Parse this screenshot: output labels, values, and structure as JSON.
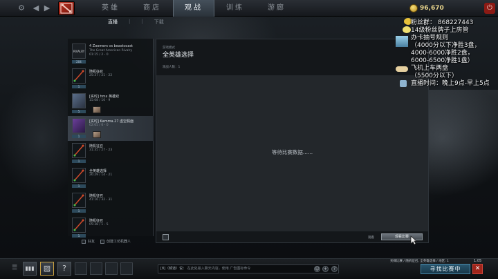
{
  "top_nav": {
    "tabs": [
      {
        "label": "英雄"
      },
      {
        "label": "商店"
      },
      {
        "label": "观战"
      },
      {
        "label": "训练"
      },
      {
        "label": "游廊"
      }
    ],
    "active_index": 2,
    "gold": "96,670"
  },
  "sub_tabs": {
    "items": [
      {
        "label": "直播"
      },
      {
        "label": "|"
      },
      {
        "label": "|"
      },
      {
        "label": "下载"
      }
    ],
    "active_index": 0
  },
  "games": [
    {
      "title": "4 Zoomers vs beastcoast",
      "subtitle": "The Great American Rivalry",
      "time": "01:15 / 2 - 0",
      "viewers": "204"
    },
    {
      "title": "随机征召",
      "subtitle": "25:37 / 21 - 22",
      "time": "",
      "viewers": "1"
    },
    {
      "title": "[实时] hmx 英雄双",
      "subtitle": "15:08 / 10 - 9",
      "time": "",
      "viewers": "5"
    },
    {
      "title": "[实时] Kamma.27 虚空假面",
      "subtitle": "02:05 / 0 - 0",
      "time": "",
      "viewers": "1"
    },
    {
      "title": "随机征召",
      "subtitle": "31:35 / 27 - 23",
      "time": "",
      "viewers": "1"
    },
    {
      "title": "全英雄选择",
      "subtitle": "26:29 / 14 - 21",
      "time": "",
      "viewers": "1"
    },
    {
      "title": "随机征召",
      "subtitle": "41:16 / 32 - 31",
      "time": "",
      "viewers": "1"
    },
    {
      "title": "随机征召",
      "subtitle": "05:38 / 1 - 5",
      "time": "",
      "viewers": "1"
    }
  ],
  "list_filters": [
    {
      "label": "好友"
    },
    {
      "label": "创建工坊机器人"
    }
  ],
  "detail": {
    "mode_label": "游戏模式",
    "mode": "全英雄选择",
    "viewers_label": "观战人数：1",
    "waiting": "等待比赛数据......",
    "watch_label": "观看",
    "watch_button": "观看比赛"
  },
  "overlay": {
    "lines": [
      "粉丝群： 868227443",
      "14级粉丝牌子上房管",
      "办卡抽号规则",
      "（4000分以下净胜3盘，",
      "4000-6000净胜2盘，",
      "6000-6500净胜1盘）",
      "飞机上车两盘",
      "（5500分以下）",
      "直播时间：晚上9点-早上5点"
    ]
  },
  "bottom_bar": {
    "help": "?",
    "chat_channel": "[8]（频道）说：",
    "chat_placeholder": "在此处输入聊天内容，使用 广告图标命令",
    "queue_status": "天梯比赛 / 随机征召, 全英雄选择 / 地区: 1",
    "clock": "1:05",
    "find_match": "寻找比赛中",
    "close": "✕"
  },
  "colors": {
    "accent_red": "#8b1a14",
    "gold": "#e8d48c",
    "find_match_blue": "#29566e"
  }
}
